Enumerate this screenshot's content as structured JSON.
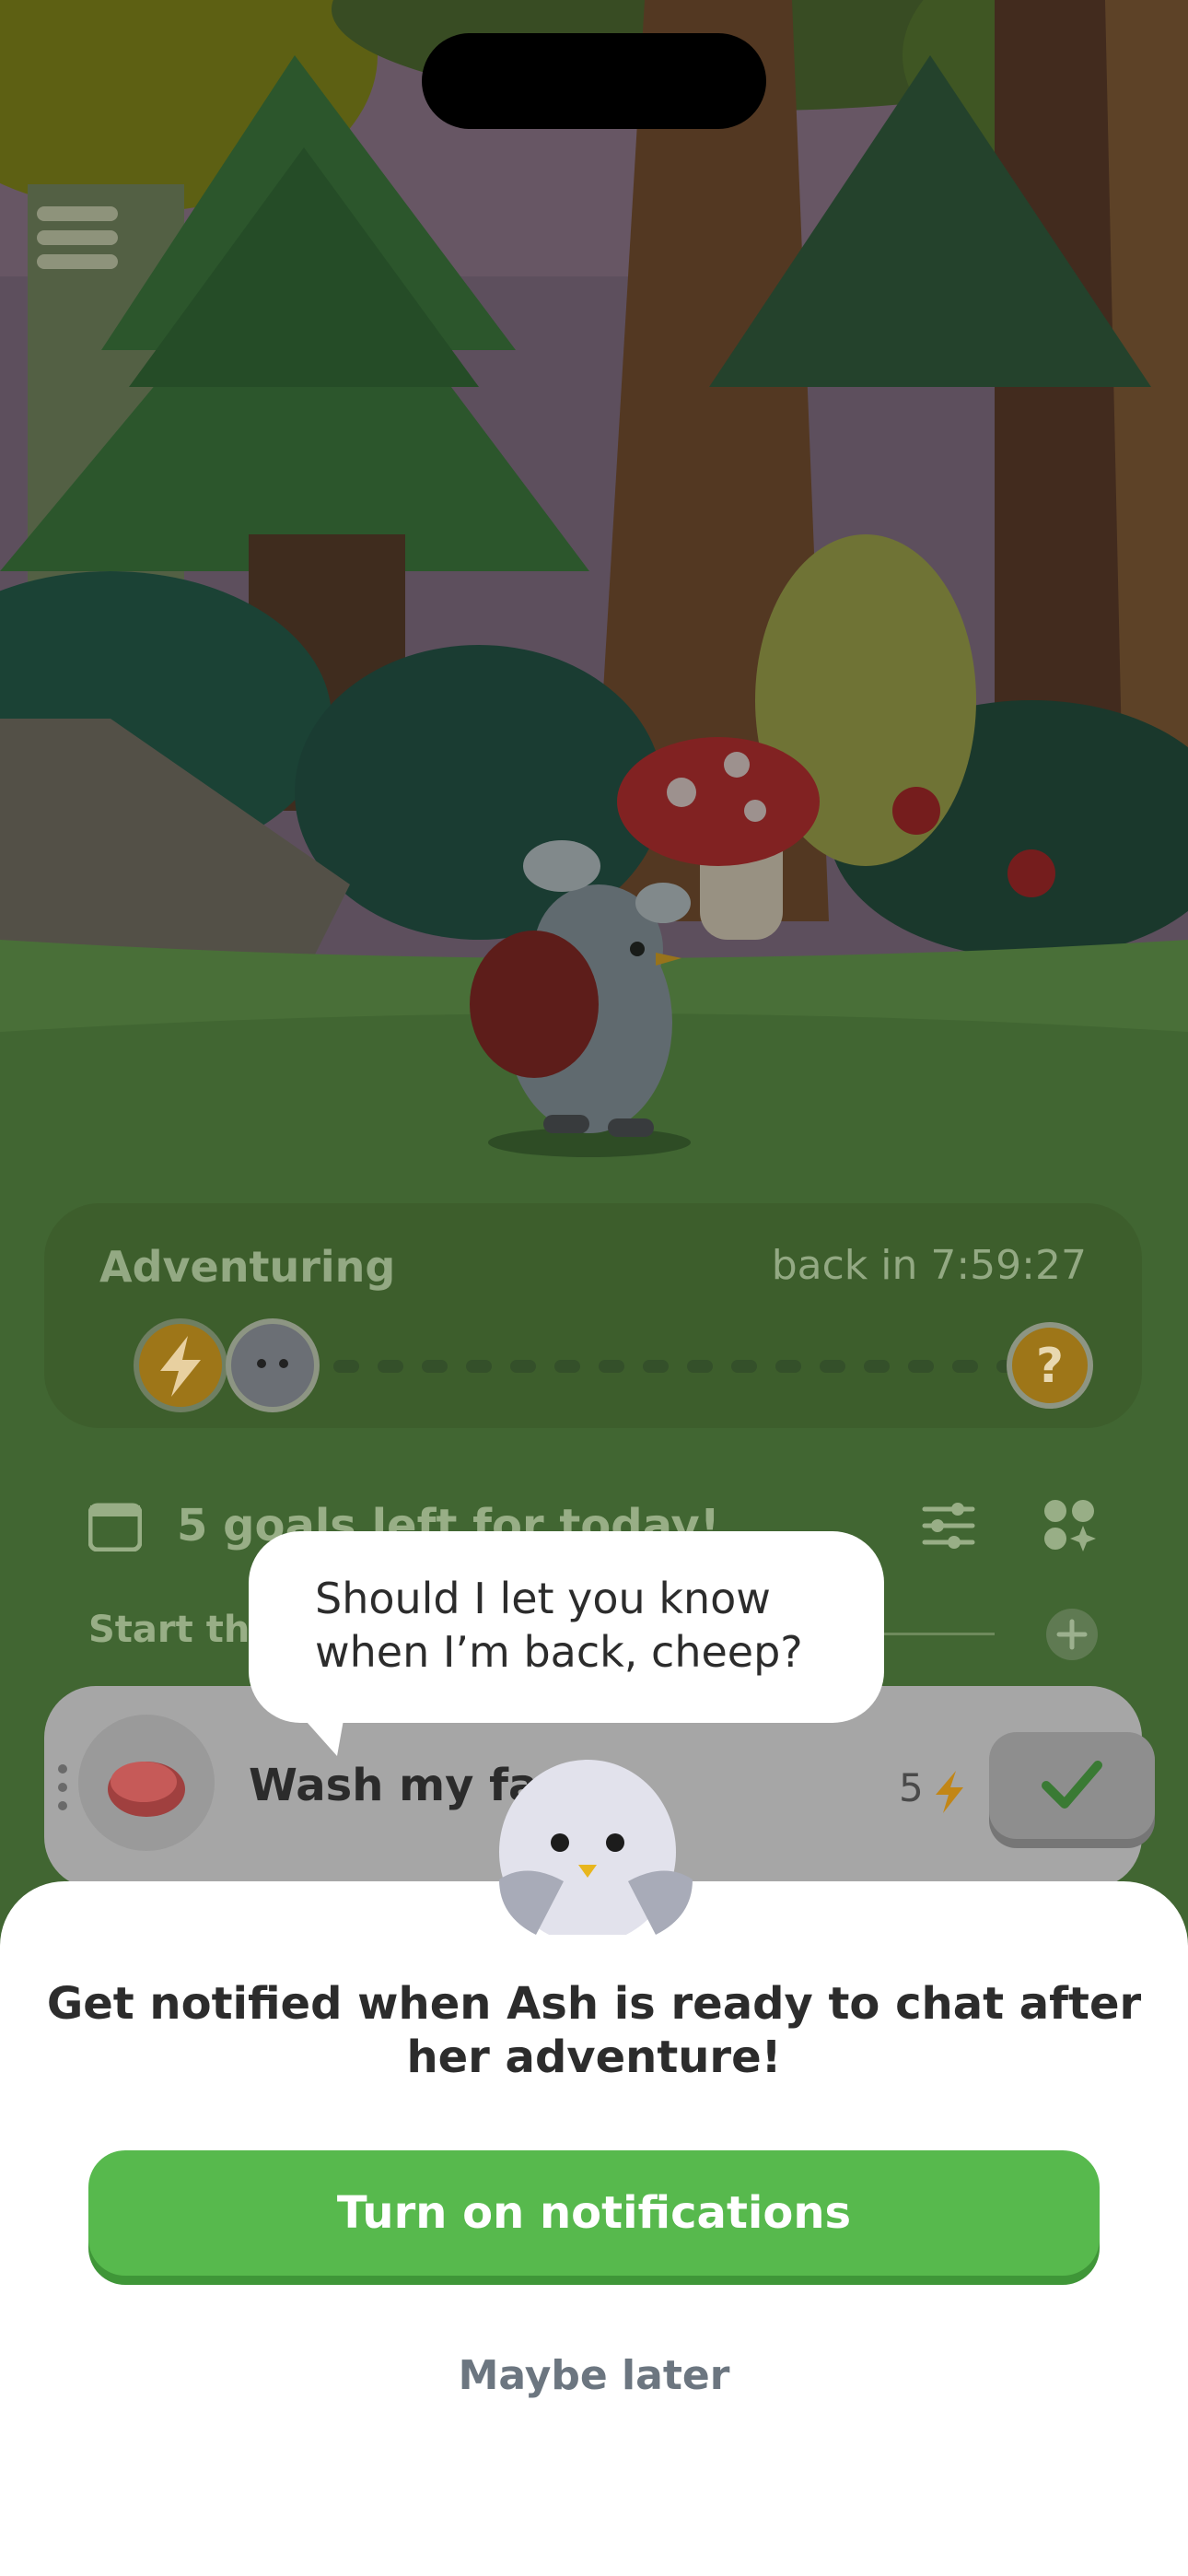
{
  "adventure": {
    "title": "Adventuring",
    "timer": "back in 7:59:27",
    "mystery_label": "?"
  },
  "goals": {
    "summary": "5 goals left for today!",
    "section_label": "Start the"
  },
  "task": {
    "name": "Wash my face",
    "points": "5"
  },
  "bubble": {
    "line1": "Should I let you know",
    "line2": "when I’m back, cheep?"
  },
  "sheet": {
    "title_line1": "Get notified when Ash is ready to chat after",
    "title_line2": "her adventure!",
    "primary_label": "Turn on notifications",
    "secondary_label": "Maybe later"
  },
  "colors": {
    "accent_green": "#57b94d",
    "energy_gold": "#d49a1a"
  }
}
